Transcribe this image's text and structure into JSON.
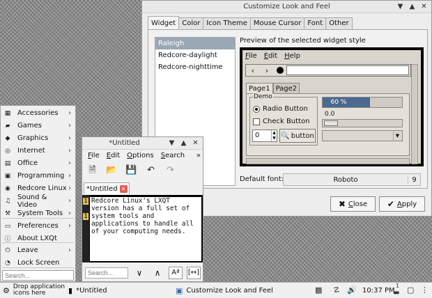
{
  "clf": {
    "title": "Customize Look and Feel",
    "tabs": [
      "Widget",
      "Color",
      "Icon Theme",
      "Mouse Cursor",
      "Font",
      "Other"
    ],
    "themes": [
      "Raleigh",
      "Redcore-daylight",
      "Redcore-nighttime"
    ],
    "preview_label": "Preview of the selected widget style",
    "preview": {
      "menu": [
        "File",
        "Edit",
        "Help"
      ],
      "tabs": [
        "Page1",
        "Page2"
      ],
      "demo_label": "Demo",
      "radio": "Radio Button",
      "check": "Check Button",
      "spin_value": "0",
      "button": "button",
      "progress_text": "60 %",
      "progress_value": 60,
      "scale_value": "0.0"
    },
    "font_label": "Default font:",
    "font_name": "Roboto",
    "font_size": "9",
    "close_label": "Close",
    "apply_label": "Apply"
  },
  "menu": {
    "items": [
      {
        "label": "Accessories",
        "icon": "accessories-icon",
        "glyph": "▦",
        "sub": true
      },
      {
        "label": "Games",
        "icon": "games-icon",
        "glyph": "▰",
        "sub": true
      },
      {
        "label": "Graphics",
        "icon": "graphics-icon",
        "glyph": "◆",
        "sub": true
      },
      {
        "label": "Internet",
        "icon": "internet-icon",
        "glyph": "◎",
        "sub": true
      },
      {
        "label": "Office",
        "icon": "office-icon",
        "glyph": "▤",
        "sub": true
      },
      {
        "label": "Programming",
        "icon": "programming-icon",
        "glyph": "▣",
        "sub": true
      },
      {
        "label": "Redcore Linux",
        "icon": "redcore-icon",
        "glyph": "◉",
        "sub": true
      },
      {
        "label": "Sound & Video",
        "icon": "sound-video-icon",
        "glyph": "♫",
        "sub": true
      },
      {
        "label": "System Tools",
        "icon": "system-tools-icon",
        "glyph": "⚒",
        "sub": true
      },
      {
        "label": "Preferences",
        "icon": "preferences-icon",
        "glyph": "▭",
        "sub": true
      },
      {
        "label": "About LXQt",
        "icon": "about-icon",
        "glyph": "ⓘ",
        "sub": false
      },
      {
        "label": "Leave",
        "icon": "leave-icon",
        "glyph": "⏻",
        "sub": true
      },
      {
        "label": "Lock Screen",
        "icon": "lock-icon",
        "glyph": "◔",
        "sub": false
      }
    ],
    "search_placeholder": "Search..."
  },
  "editor": {
    "title": "*Untitled",
    "menu": [
      "File",
      "Edit",
      "Options",
      "Search"
    ],
    "tab_label": "*Untitled",
    "lines": [
      {
        "num": "1",
        "text": "Redcore Linux's LXQT version has a full set of system tools and applications to"
      },
      {
        "num": "1",
        "text": "handle all of your computing needs."
      }
    ],
    "search_placeholder": "Search...",
    "case_label": "Aª",
    "whole_label": "[↔]"
  },
  "taskbar": {
    "drop_text": "Drop application icons here",
    "task1": "*Untitled",
    "task2": "Customize Look and Feel",
    "clock": "10:37 PM",
    "badge": "1"
  }
}
